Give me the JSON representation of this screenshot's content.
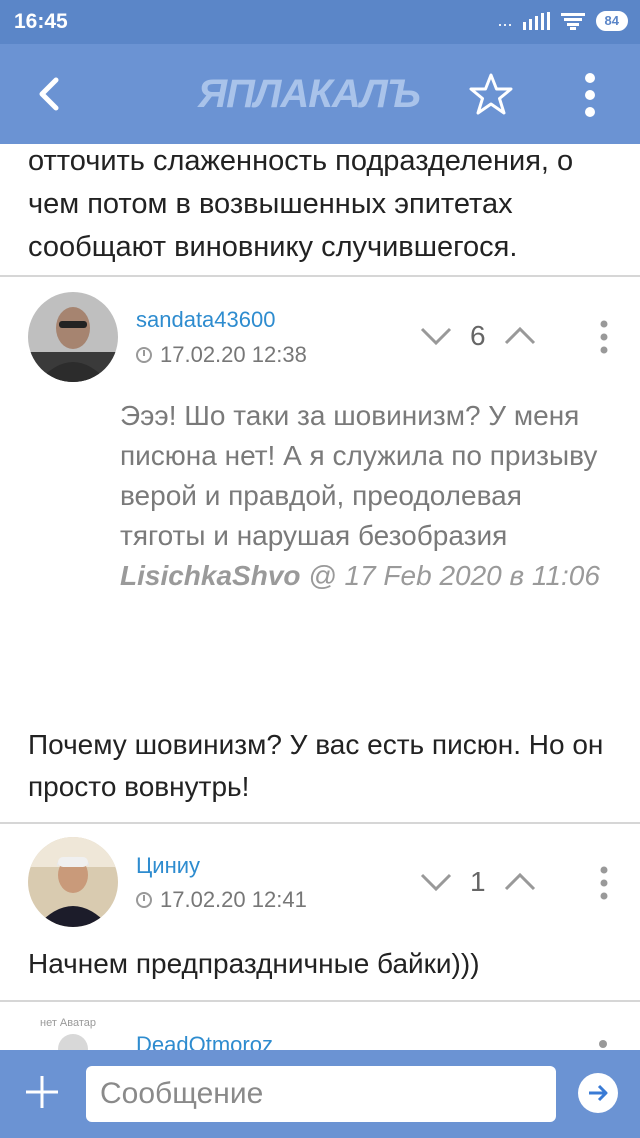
{
  "status_bar": {
    "time": "16:45",
    "signal_dots": "...",
    "battery": "84"
  },
  "app_bar": {
    "logo": "ЯПЛАКАЛЪ"
  },
  "intro_text": "отточить слаженность подразделения, о чем потом в возвышенных эпитетах сообщают виновнику случившегося.",
  "comments": [
    {
      "username": "sandata43600",
      "datetime": "17.02.20 12:38",
      "votes": "6",
      "quote": "Эээ! Шо таки за шовинизм? У меня писюна нет! А я служила по призыву верой и правдой, преодолевая тяготы и нарушая безобразия",
      "quote_author": "LisichkaShvo",
      "quote_meta": " @ 17 Feb 2020 в 11:06",
      "text": "Почему шовинизм? У вас есть писюн. Но он просто вовнутрь!"
    },
    {
      "username": "Циниу",
      "datetime": "17.02.20 12:41",
      "votes": "1",
      "text": "Начнем предпраздничные байки)))"
    },
    {
      "username": "DeadOtmoroz",
      "avatar_label": "нет Аватар"
    }
  ],
  "composer": {
    "placeholder": "Сообщение"
  },
  "colors": {
    "bar": "#6b93d3",
    "status": "#5b86c8",
    "link": "#2e8ccf"
  }
}
